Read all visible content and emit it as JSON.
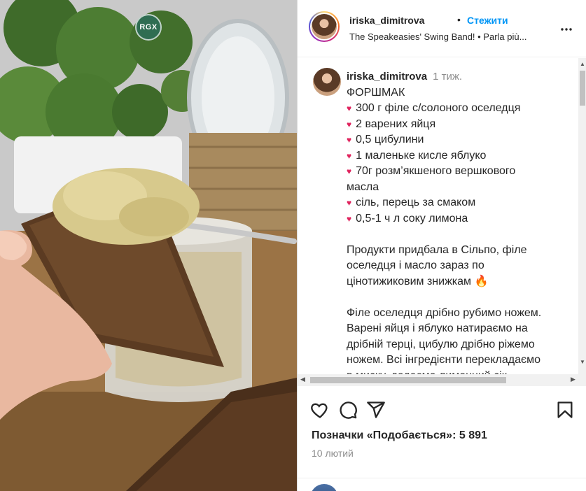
{
  "media": {
    "badge": "RGX"
  },
  "header": {
    "username": "iriska_dimitrova",
    "separator": "•",
    "follow_label": "Стежити",
    "audio": "The Speakeasies' Swing Band! • Parla più..."
  },
  "caption": {
    "username": "iriska_dimitrova",
    "time": "1 тиж.",
    "title": "ФОРШМАК",
    "ingredients": [
      "300 г філе с/солоного оселедця",
      "2 варених яйця",
      "0,5 цибулини",
      "1 маленьке кисле яблуко",
      "70г розм’якшеного вершкового",
      "масла",
      "сіль, перець за смаком",
      "0,5-1 ч л соку лимона"
    ],
    "para1": [
      "Продукти придбала в Сільпо, філе",
      "оселедця і масло зараз по",
      "цінотижиковим знижкам"
    ],
    "para2": [
      "Філе оселедця дрібно рубимо ножем.",
      "Варені яйця і яблуко натираємо на",
      "дрібній терці, цибулю дрібно ріжемо",
      "ножем. Всі інгредієнти перекладаємо",
      "в миску, додаємо лимонний сік"
    ]
  },
  "stats": {
    "likes": "Позначки «Подобається»: 5 891",
    "date": "10 лютий"
  },
  "icons": {
    "heart": "heart-icon",
    "comment": "comment-icon",
    "share": "share-icon",
    "save": "bookmark-icon",
    "more": "more-icon"
  },
  "colors": {
    "link": "#0095f6",
    "heart_bullet": "#e0245e",
    "muted": "#8e8e8e"
  }
}
